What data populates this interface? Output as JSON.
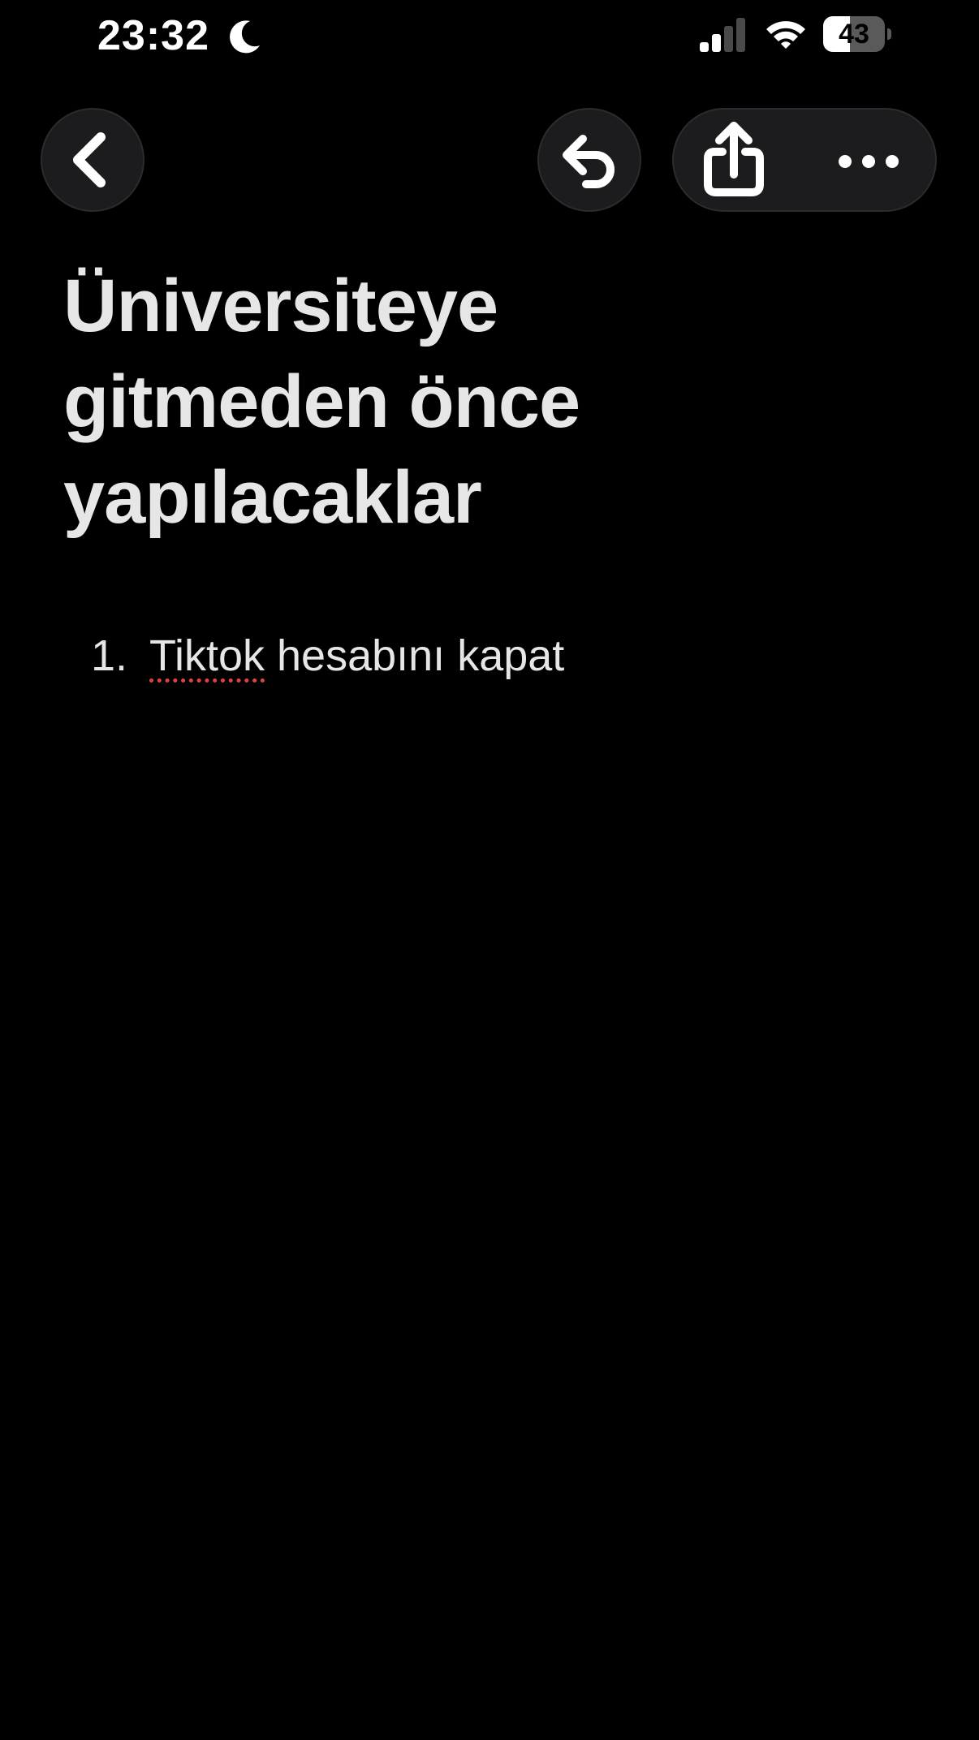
{
  "status_bar": {
    "time": "23:32",
    "battery_level": "43",
    "battery_percent": 43,
    "signal_bars_active": 2,
    "signal_bars_total": 4
  },
  "icons": {
    "focus": "moon-icon",
    "signal": "cellular-signal-icon",
    "wifi": "wifi-icon",
    "back": "chevron-left-icon",
    "undo": "undo-arrow-icon",
    "share": "share-icon",
    "more": "ellipsis-icon"
  },
  "note": {
    "title_lines": [
      "Üniversiteye",
      "gitmeden önce",
      "yapılacaklar"
    ],
    "items": [
      {
        "number": "1.",
        "misspelled_word": "Tiktok",
        "rest": " hesabını kapat"
      }
    ]
  },
  "colors": {
    "background": "#000000",
    "button_background": "#1c1c1e",
    "text": "#e6e6e6",
    "spellcheck_underline": "#e0443e"
  }
}
